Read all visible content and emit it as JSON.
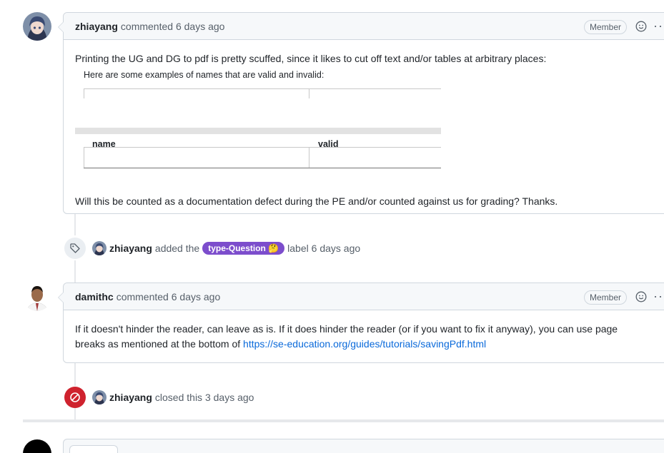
{
  "comment1": {
    "author": "zhiayang",
    "action": "commented",
    "time": "6 days ago",
    "badge": "Member",
    "body_intro": "Printing the UG and DG to pdf is pretty scuffed, since it likes to cut off text and/or tables at arbitrary places:",
    "snapshot_caption": "Here are some examples of names that are valid and invalid:",
    "table_headers": [
      "name",
      "valid"
    ],
    "body_outro": "Will this be counted as a documentation defect during the PE and/or counted against us for grading? Thanks."
  },
  "event_label": {
    "actor": "zhiayang",
    "text_before": "added the",
    "label": "type-Question 🤔",
    "text_after": "label",
    "time": "6 days ago"
  },
  "comment2": {
    "author": "damithc",
    "action": "commented",
    "time": "6 days ago",
    "badge": "Member",
    "body_text": "If it doesn't hinder the reader, can leave as is. If it does hinder the reader (or if you want to fix it anyway), you can use page breaks as mentioned at the bottom of",
    "link": "https://se-education.org/guides/tutorials/savingPdf.html"
  },
  "event_closed": {
    "actor": "zhiayang",
    "text": "closed this",
    "time": "3 days ago"
  },
  "icons": [
    "tag-icon",
    "closed-icon",
    "smiley-icon",
    "kebab-icon"
  ],
  "colors": {
    "label": "#7c4dcc",
    "closed": "#cf222e",
    "link": "#0969da"
  }
}
